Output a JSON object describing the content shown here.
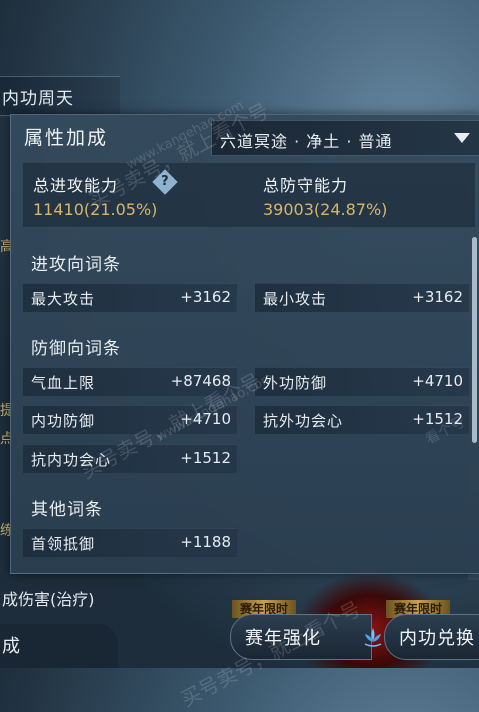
{
  "background": {
    "left_tab": "内功周天",
    "lower_left": "成伤害(治疗)",
    "bottom_left": "成",
    "side_chars": [
      "高",
      "提",
      "点",
      "练"
    ]
  },
  "events": [
    {
      "tag": "赛年限时",
      "label": "赛年强化"
    },
    {
      "tag": "赛年限时",
      "label": "内功兑换"
    }
  ],
  "panel": {
    "title": "属性加成",
    "dropdown_value": "六道冥途 · 净土 · 普通",
    "summary": {
      "attack_label": "总进攻能力",
      "attack_value": "11410(21.05%)",
      "defense_label": "总防守能力",
      "defense_value": "39003(24.87%)"
    },
    "sections": {
      "offense": "进攻向词条",
      "defense": "防御向词条",
      "other": "其他词条"
    },
    "offense_stats": [
      {
        "name": "最大攻击",
        "value": "+3162"
      },
      {
        "name": "最小攻击",
        "value": "+3162"
      }
    ],
    "defense_stats": [
      {
        "name": "气血上限",
        "value": "+87468"
      },
      {
        "name": "外功防御",
        "value": "+4710"
      },
      {
        "name": "内功防御",
        "value": "+4710"
      },
      {
        "name": "抗外功会心",
        "value": "+1512"
      },
      {
        "name": "抗内功会心",
        "value": "+1512"
      }
    ],
    "other_stats": [
      {
        "name": "首领抵御",
        "value": "+1188"
      }
    ]
  },
  "watermark": {
    "line1": "买号卖号，就上看个号",
    "line2": "www.kangehao.com",
    "line3": "看个号"
  },
  "colors": {
    "gold_value": "#d7b66a",
    "panel_bg": "#344a5c"
  }
}
